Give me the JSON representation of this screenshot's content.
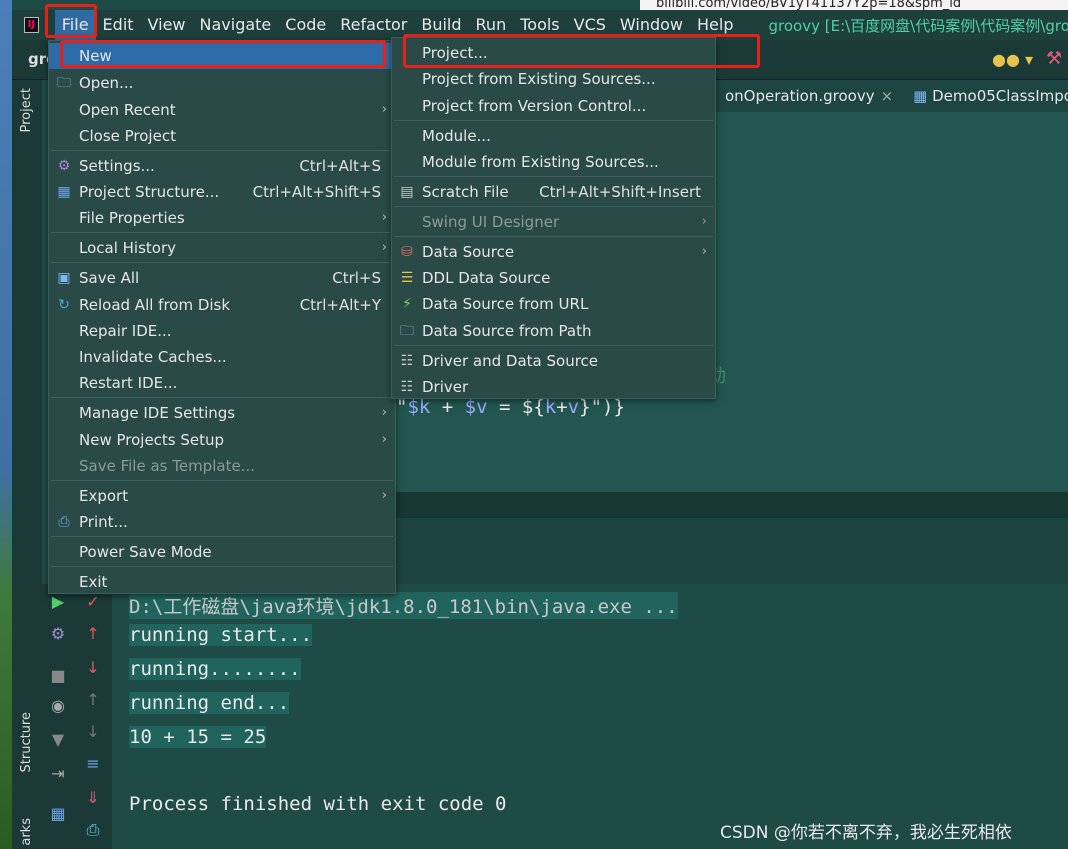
{
  "browser": {
    "url_fragment": "bilibili.com/video/BV1yT41137Y2p=18&spm_id"
  },
  "menubar": {
    "items": [
      "File",
      "Edit",
      "View",
      "Navigate",
      "Code",
      "Refactor",
      "Build",
      "Run",
      "Tools",
      "VCS",
      "Window",
      "Help"
    ],
    "title_path": "groovy [E:\\百度网盘\\代码案例\\代码案例\\groovy"
  },
  "toolbar": {
    "project_name": "gro"
  },
  "tabs": [
    {
      "label": "onOperation.groovy",
      "close": "×"
    },
    {
      "label": "Demo05ClassImpor"
    }
  ],
  "side_labels": {
    "project": "Project",
    "structure": "Structure",
    "bookmarks": "arks"
  },
  "file_menu": {
    "items": [
      {
        "label": "New",
        "arrow": "›",
        "selected": true
      },
      {
        "label": "Open...",
        "icon": "folder-icon"
      },
      {
        "label": "Open Recent",
        "arrow": "›"
      },
      {
        "label": "Close Project"
      },
      {
        "label": "Settings...",
        "shortcut": "Ctrl+Alt+S",
        "icon": "gear-icon"
      },
      {
        "label": "Project Structure...",
        "shortcut": "Ctrl+Alt+Shift+S",
        "icon": "grid-icon"
      },
      {
        "label": "File Properties",
        "arrow": "›"
      },
      {
        "label": "Local History",
        "arrow": "›"
      },
      {
        "label": "Save All",
        "shortcut": "Ctrl+S",
        "icon": "save-icon"
      },
      {
        "label": "Reload All from Disk",
        "shortcut": "Ctrl+Alt+Y",
        "icon": "reload-icon"
      },
      {
        "label": "Repair IDE..."
      },
      {
        "label": "Invalidate Caches..."
      },
      {
        "label": "Restart IDE..."
      },
      {
        "label": "Manage IDE Settings",
        "arrow": "›"
      },
      {
        "label": "New Projects Setup",
        "arrow": "›"
      },
      {
        "label": "Save File as Template...",
        "disabled": true
      },
      {
        "label": "Export",
        "arrow": "›"
      },
      {
        "label": "Print...",
        "icon": "print-icon"
      },
      {
        "label": "Power Save Mode"
      },
      {
        "label": "Exit"
      }
    ]
  },
  "new_menu": {
    "items": [
      {
        "label": "Project..."
      },
      {
        "label": "Project from Existing Sources..."
      },
      {
        "label": "Project from Version Control..."
      },
      {
        "label": "Module..."
      },
      {
        "label": "Module from Existing Sources..."
      },
      {
        "label": "Scratch File",
        "shortcut": "Ctrl+Alt+Shift+Insert",
        "icon": "scratch-file-icon"
      },
      {
        "label": "Swing UI Designer",
        "arrow": "›",
        "disabled": true
      },
      {
        "label": "Data Source",
        "arrow": "›",
        "icon": "database-icon"
      },
      {
        "label": "DDL Data Source",
        "icon": "ddl-icon"
      },
      {
        "label": "Data Source from URL",
        "icon": "plug-icon"
      },
      {
        "label": "Data Source from Path",
        "icon": "folder-icon"
      },
      {
        "label": "Driver and Data Source",
        "icon": "driver-icon"
      },
      {
        "label": "Driver",
        "icon": "driver-icon"
      }
    ]
  },
  "editor": {
    "code_parts": [
      "\"",
      "$k",
      " + ",
      "$v",
      " = ${",
      "k",
      "+",
      "v",
      "}\")}"
    ],
    "faint_char": "动"
  },
  "console": {
    "lines": [
      "D:\\工作磁盘\\java环境\\jdk1.8.0_181\\bin\\java.exe ...",
      "running start...",
      "running........",
      "running end...",
      "10 + 15 = 25",
      "Process finished with exit code 0"
    ]
  },
  "watermark": "CSDN @你若不离不弃，我必生死相依"
}
